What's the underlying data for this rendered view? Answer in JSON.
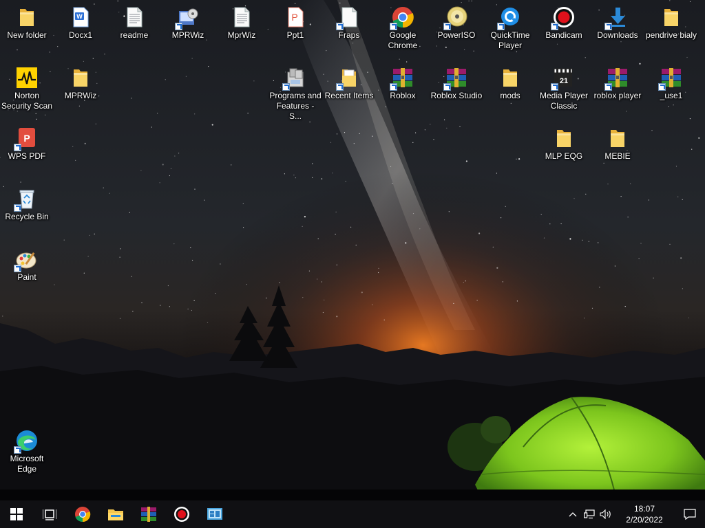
{
  "desktop": {
    "icons": [
      {
        "label": "New folder",
        "icon": "folder-icon"
      },
      {
        "label": "Docx1",
        "icon": "word-doc-icon"
      },
      {
        "label": "readme",
        "icon": "text-file-icon"
      },
      {
        "label": "MPRWiz",
        "icon": "mprwiz-app-icon"
      },
      {
        "label": "MprWiz",
        "icon": "text-file-icon"
      },
      {
        "label": "Ppt1",
        "icon": "wps-presentation-icon"
      },
      {
        "label": "Fraps",
        "icon": "generic-file-icon"
      },
      {
        "label": "Google Chrome",
        "icon": "chrome-icon"
      },
      {
        "label": "PowerISO",
        "icon": "poweriso-disc-icon"
      },
      {
        "label": "QuickTime Player",
        "icon": "quicktime-icon"
      },
      {
        "label": "Bandicam",
        "icon": "bandicam-record-icon"
      },
      {
        "label": "Downloads",
        "icon": "downloads-icon"
      },
      {
        "label": "pendrive bialy",
        "icon": "folder-icon"
      },
      {
        "label": "Norton Security Scan",
        "icon": "norton-icon"
      },
      {
        "label": "MPRWiz",
        "icon": "folder-icon"
      },
      {
        "label": "Programs and Features - S...",
        "icon": "programs-features-icon"
      },
      {
        "label": "Recent Items",
        "icon": "recent-items-folder-icon"
      },
      {
        "label": "Roblox",
        "icon": "winrar-archive-icon"
      },
      {
        "label": "Roblox Studio",
        "icon": "winrar-archive-icon"
      },
      {
        "label": "mods",
        "icon": "folder-icon"
      },
      {
        "label": "Media Player Classic",
        "icon": "media-player-classic-icon"
      },
      {
        "label": "roblox player",
        "icon": "winrar-archive-icon"
      },
      {
        "label": "_use1",
        "icon": "winrar-archive-icon"
      },
      {
        "label": "WPS PDF",
        "icon": "wps-pdf-icon"
      },
      {
        "label": "MLP EQG",
        "icon": "folder-icon"
      },
      {
        "label": "MEBIE",
        "icon": "folder-icon"
      },
      {
        "label": "Recycle Bin",
        "icon": "recycle-bin-icon"
      },
      {
        "label": "Paint",
        "icon": "paint-icon"
      },
      {
        "label": "Microsoft Edge",
        "icon": "edge-icon"
      }
    ]
  },
  "taskbar": {
    "pinned": [
      {
        "name": "start",
        "icon": "windows-start-icon"
      },
      {
        "name": "task-view",
        "icon": "task-view-icon"
      },
      {
        "name": "chrome",
        "icon": "chrome-icon"
      },
      {
        "name": "file-explorer",
        "icon": "file-explorer-icon"
      },
      {
        "name": "winrar",
        "icon": "winrar-icon"
      },
      {
        "name": "bandicam",
        "icon": "bandicam-record-icon"
      },
      {
        "name": "control-panel",
        "icon": "control-panel-icon"
      }
    ],
    "tray": {
      "time": "18:07",
      "date": "2/20/2022",
      "icons": [
        "chevron-up-icon",
        "network-icon",
        "volume-icon"
      ],
      "notification_icon": "action-center-icon"
    }
  },
  "colors": {
    "taskbar": "#101013",
    "accent": "#76b9ed",
    "tent": "#8ad21e",
    "glow": "#e0661c",
    "folder": "#f4c64e"
  }
}
